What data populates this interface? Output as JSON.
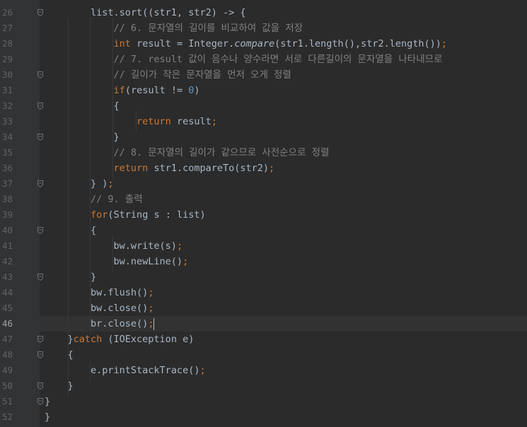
{
  "editor": {
    "current_line": "46",
    "lines": [
      {
        "n": "26",
        "tokens": [
          {
            "t": "        list.sort((str1, str2) -> {",
            "c": "code"
          }
        ]
      },
      {
        "n": "27",
        "tokens": [
          {
            "t": "            // 6. 문자열의 길이를 비교하여 값을 저장",
            "c": "cm"
          }
        ]
      },
      {
        "n": "28",
        "tokens": [
          {
            "t": "            ",
            "c": "code"
          },
          {
            "t": "int",
            "c": "kw"
          },
          {
            "t": " result = Integer.",
            "c": "code"
          },
          {
            "t": "compare",
            "c": "it"
          },
          {
            "t": "(str1.length(),str2.length())",
            "c": "code"
          },
          {
            "t": ";",
            "c": "sep"
          }
        ]
      },
      {
        "n": "29",
        "tokens": [
          {
            "t": "            // 7. result 값이 음수나 양수라면 서로 다른길이의 문자열을 나타내므로",
            "c": "cm"
          }
        ]
      },
      {
        "n": "30",
        "tokens": [
          {
            "t": "            // 길이가 작은 문자열을 먼저 오게 정렬",
            "c": "cm"
          }
        ]
      },
      {
        "n": "31",
        "tokens": [
          {
            "t": "            ",
            "c": "code"
          },
          {
            "t": "if",
            "c": "kw"
          },
          {
            "t": "(result != ",
            "c": "code"
          },
          {
            "t": "0",
            "c": "num"
          },
          {
            "t": ")",
            "c": "code"
          }
        ]
      },
      {
        "n": "32",
        "tokens": [
          {
            "t": "            {",
            "c": "code"
          }
        ]
      },
      {
        "n": "33",
        "tokens": [
          {
            "t": "                ",
            "c": "code"
          },
          {
            "t": "return",
            "c": "kw"
          },
          {
            "t": " result",
            "c": "code"
          },
          {
            "t": ";",
            "c": "sep"
          }
        ]
      },
      {
        "n": "34",
        "tokens": [
          {
            "t": "            }",
            "c": "code"
          }
        ]
      },
      {
        "n": "35",
        "tokens": [
          {
            "t": "            // 8. 문자열의 길이가 같으므로 사전순으로 정렬",
            "c": "cm"
          }
        ]
      },
      {
        "n": "36",
        "tokens": [
          {
            "t": "            ",
            "c": "code"
          },
          {
            "t": "return",
            "c": "kw"
          },
          {
            "t": " str1.compareTo(str2)",
            "c": "code"
          },
          {
            "t": ";",
            "c": "sep"
          }
        ]
      },
      {
        "n": "37",
        "tokens": [
          {
            "t": "        } )",
            "c": "code"
          },
          {
            "t": ";",
            "c": "sep"
          }
        ]
      },
      {
        "n": "38",
        "tokens": [
          {
            "t": "        // 9. 출력",
            "c": "cm"
          }
        ]
      },
      {
        "n": "39",
        "tokens": [
          {
            "t": "        ",
            "c": "code"
          },
          {
            "t": "for",
            "c": "kw"
          },
          {
            "t": "(String s : list)",
            "c": "code"
          }
        ]
      },
      {
        "n": "40",
        "tokens": [
          {
            "t": "        {",
            "c": "code"
          }
        ]
      },
      {
        "n": "41",
        "tokens": [
          {
            "t": "            bw.write(s)",
            "c": "code"
          },
          {
            "t": ";",
            "c": "sep"
          }
        ]
      },
      {
        "n": "42",
        "tokens": [
          {
            "t": "            bw.newLine()",
            "c": "code"
          },
          {
            "t": ";",
            "c": "sep"
          }
        ]
      },
      {
        "n": "43",
        "tokens": [
          {
            "t": "        }",
            "c": "code"
          }
        ]
      },
      {
        "n": "44",
        "tokens": [
          {
            "t": "        bw.flush()",
            "c": "code"
          },
          {
            "t": ";",
            "c": "sep"
          }
        ]
      },
      {
        "n": "45",
        "tokens": [
          {
            "t": "        bw.close()",
            "c": "code"
          },
          {
            "t": ";",
            "c": "sep"
          }
        ]
      },
      {
        "n": "46",
        "tokens": [
          {
            "t": "        br.close()",
            "c": "code"
          },
          {
            "t": ";",
            "c": "sep"
          }
        ]
      },
      {
        "n": "47",
        "tokens": [
          {
            "t": "    }",
            "c": "code"
          },
          {
            "t": "catch",
            "c": "kw"
          },
          {
            "t": " (IOException e)",
            "c": "code"
          }
        ]
      },
      {
        "n": "48",
        "tokens": [
          {
            "t": "    {",
            "c": "code"
          }
        ]
      },
      {
        "n": "49",
        "tokens": [
          {
            "t": "        e.printStackTrace()",
            "c": "code"
          },
          {
            "t": ";",
            "c": "sep"
          }
        ]
      },
      {
        "n": "50",
        "tokens": [
          {
            "t": "    }",
            "c": "code"
          }
        ]
      },
      {
        "n": "51",
        "tokens": [
          {
            "t": "}",
            "c": "code"
          }
        ]
      },
      {
        "n": "52",
        "tokens": [
          {
            "t": "}",
            "c": "code"
          }
        ]
      }
    ]
  },
  "colors": {
    "background": "#2b2b2b",
    "gutter": "#313335",
    "keyword": "#cc7832",
    "comment": "#808080",
    "number": "#6897bb",
    "text": "#a9b7c6"
  }
}
